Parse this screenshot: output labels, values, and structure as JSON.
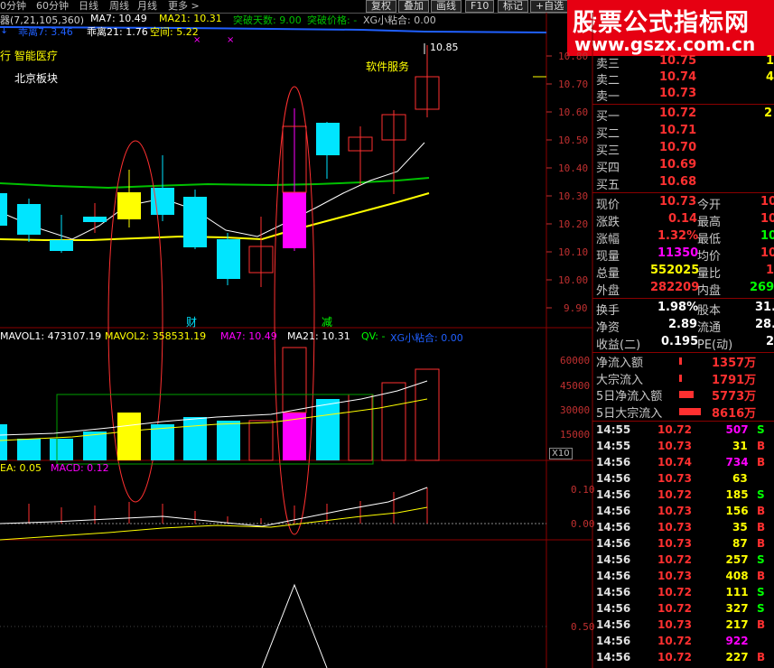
{
  "toolbar": {
    "tabs": [
      "0分钟",
      "60分钟",
      "日线",
      "周线",
      "月线",
      "更多 >"
    ],
    "buttons": [
      "复权",
      "叠加",
      "画线",
      "F10",
      "标记",
      "+自选"
    ]
  },
  "logo": {
    "line1": "股票公式指标网",
    "line2": "www.gszx.com.cn"
  },
  "price_panel": {
    "indicator_row1": {
      "name": "器(7,21,105,360)",
      "ma7": "MA7: 10.49",
      "ma21": "MA21: 10.31",
      "break_days": "突破天数: 9.00",
      "break_price": "突破价格: -",
      "xg": "XG小粘合: 0.00"
    },
    "indicator_row2": {
      "deviation7": "乖离7: 3.46",
      "deviation21": "乖离21: 1.76",
      "space": "空间: 5.22"
    },
    "sector_label": "行 智能医疗",
    "board_label": "北京板块",
    "software_label": "软件服务",
    "peak_label": "10.85",
    "markers": [
      "财",
      "减"
    ],
    "price_scale": [
      "10.80",
      "10.70",
      "10.60",
      "10.50",
      "10.40",
      "10.30",
      "10.20",
      "10.10",
      "10.00",
      "9.90"
    ]
  },
  "volume_panel": {
    "header": {
      "mavol1": "MAVOL1: 473107.19",
      "mavol2": "MAVOL2: 358531.19",
      "ma7": "MA7: 10.49",
      "ma21": "MA21: 10.31",
      "qv": "QV: -",
      "xg": "XG小粘合: 0.00"
    },
    "scale": [
      "60000",
      "45000",
      "30000",
      "15000"
    ],
    "unit": "X10"
  },
  "macd_panel": {
    "header": {
      "dea": "EA: 0.05",
      "macd": "MACD: 0.12"
    },
    "scale": [
      "0.10",
      "0.00"
    ]
  },
  "lower_panel": {
    "scale": [
      "0.50"
    ]
  },
  "quote": {
    "asks": [
      {
        "label": "卖三",
        "price": "10.75",
        "vol": "1"
      },
      {
        "label": "卖二",
        "price": "10.74",
        "vol": "4"
      },
      {
        "label": "卖一",
        "price": "10.73",
        "vol": ""
      }
    ],
    "bids": [
      {
        "label": "买一",
        "price": "10.72",
        "vol": "2"
      },
      {
        "label": "买二",
        "price": "10.71",
        "vol": ""
      },
      {
        "label": "买三",
        "price": "10.70",
        "vol": ""
      },
      {
        "label": "买四",
        "price": "10.69",
        "vol": ""
      },
      {
        "label": "买五",
        "price": "10.68",
        "vol": ""
      }
    ],
    "stats": [
      {
        "l1": "现价",
        "v1": "10.73",
        "l2": "今开",
        "v2": "10"
      },
      {
        "l1": "涨跌",
        "v1": "0.14",
        "l2": "最高",
        "v2": "10"
      },
      {
        "l1": "涨幅",
        "v1": "1.32%",
        "l2": "最低",
        "v2": "10"
      },
      {
        "l1": "现量",
        "v1": "11350",
        "l2": "均价",
        "v2": "10"
      },
      {
        "l1": "总量",
        "v1": "552025",
        "l2": "量比",
        "v2": "1"
      },
      {
        "l1": "外盘",
        "v1": "282209",
        "l2": "内盘",
        "v2": "269"
      }
    ],
    "fund": [
      {
        "l1": "换手",
        "v1": "1.98%",
        "l2": "股本",
        "v2": "31."
      },
      {
        "l1": "净资",
        "v1": "2.89",
        "l2": "流通",
        "v2": "28."
      },
      {
        "l1": "收益(二)",
        "v1": "0.195",
        "l2": "PE(动)",
        "v2": "2"
      }
    ],
    "flows": [
      {
        "label": "净流入额",
        "value": "1357万"
      },
      {
        "label": "大宗流入",
        "value": "1791万"
      },
      {
        "label": "5日净流入额",
        "value": "5773万"
      },
      {
        "label": "5日大宗流入",
        "value": "8616万"
      }
    ]
  },
  "ticks": [
    {
      "t": "14:55",
      "p": "10.72",
      "v": "507",
      "s": "S"
    },
    {
      "t": "14:55",
      "p": "10.73",
      "v": "31",
      "s": "B"
    },
    {
      "t": "14:56",
      "p": "10.74",
      "v": "734",
      "s": "B"
    },
    {
      "t": "14:56",
      "p": "10.73",
      "v": "63",
      "s": ""
    },
    {
      "t": "14:56",
      "p": "10.72",
      "v": "185",
      "s": "S"
    },
    {
      "t": "14:56",
      "p": "10.73",
      "v": "156",
      "s": "B"
    },
    {
      "t": "14:56",
      "p": "10.73",
      "v": "35",
      "s": "B"
    },
    {
      "t": "14:56",
      "p": "10.73",
      "v": "87",
      "s": "B"
    },
    {
      "t": "14:56",
      "p": "10.72",
      "v": "257",
      "s": "S"
    },
    {
      "t": "14:56",
      "p": "10.73",
      "v": "408",
      "s": "B"
    },
    {
      "t": "14:56",
      "p": "10.72",
      "v": "111",
      "s": "S"
    },
    {
      "t": "14:56",
      "p": "10.72",
      "v": "327",
      "s": "S"
    },
    {
      "t": "14:56",
      "p": "10.73",
      "v": "217",
      "s": "B"
    },
    {
      "t": "14:56",
      "p": "10.72",
      "v": "922",
      "s": ""
    },
    {
      "t": "14:56",
      "p": "10.72",
      "v": "227",
      "s": "B"
    }
  ],
  "colors": {
    "up": "#ff3030",
    "down": "#00e5ff",
    "yellow": "#ffff00",
    "magenta": "#ff00ff",
    "ma_white": "#ffffff",
    "ma_yellow": "#ffff00",
    "ma_green": "#00c000",
    "ma_blue": "#2060ff"
  }
}
